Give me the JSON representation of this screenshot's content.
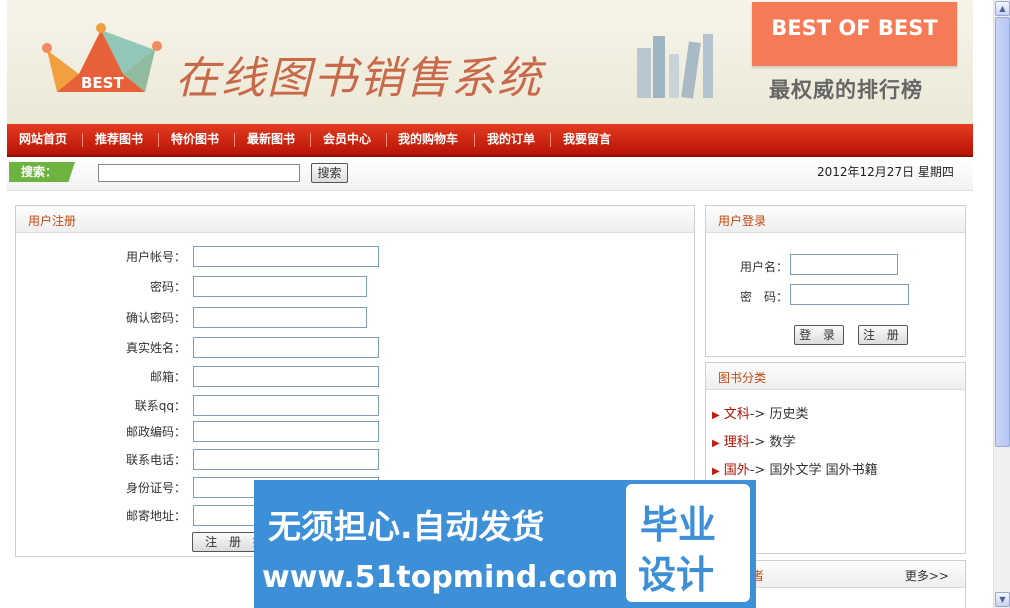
{
  "banner": {
    "logo_text": "BEST",
    "site_title": "在线图书销售系统",
    "best_tag": "BEST OF BEST",
    "best_sub": "最权威的排行榜"
  },
  "nav": {
    "items": [
      "网站首页",
      "推荐图书",
      "特价图书",
      "最新图书",
      "会员中心",
      "我的购物车",
      "我的订单",
      "我要留言"
    ]
  },
  "search": {
    "label": "搜索：",
    "value": "",
    "button": "搜索",
    "date": "2012年12月27日 星期四"
  },
  "register": {
    "title": "用户注册",
    "fields": [
      "用户帐号：",
      "密码：",
      "确认密码：",
      "真实姓名：",
      "邮箱：",
      "联系qq：",
      "邮政编码：",
      "联系电话：",
      "身份证号：",
      "邮寄地址："
    ],
    "submit": "注 册 提"
  },
  "login": {
    "title": "用户登录",
    "username_label": "用户名：",
    "password_label": "密　码：",
    "login_btn": "登 录",
    "register_btn": "注 册"
  },
  "categories": {
    "title": "图书分类",
    "rows": [
      {
        "main": "文科",
        "sep": "->",
        "subs": "历史类"
      },
      {
        "main": "理科",
        "sep": "->",
        "subs": "数学"
      },
      {
        "main": "国外",
        "sep": "->",
        "subs": "国外文学  国外书籍"
      }
    ]
  },
  "bottom_panel": {
    "title_partial": "者",
    "more": "更多>>"
  },
  "watermark": {
    "line1": "无须担心.自动发货",
    "line2": "www.51topmind.com",
    "box1": "毕业",
    "box2": "设计"
  },
  "colors": {
    "nav_red": "#cc2412",
    "accent_orange": "#f47b55",
    "search_green": "#6db33f",
    "panel_title": "#c14a10",
    "watermark_blue": "#3d8fd8"
  }
}
